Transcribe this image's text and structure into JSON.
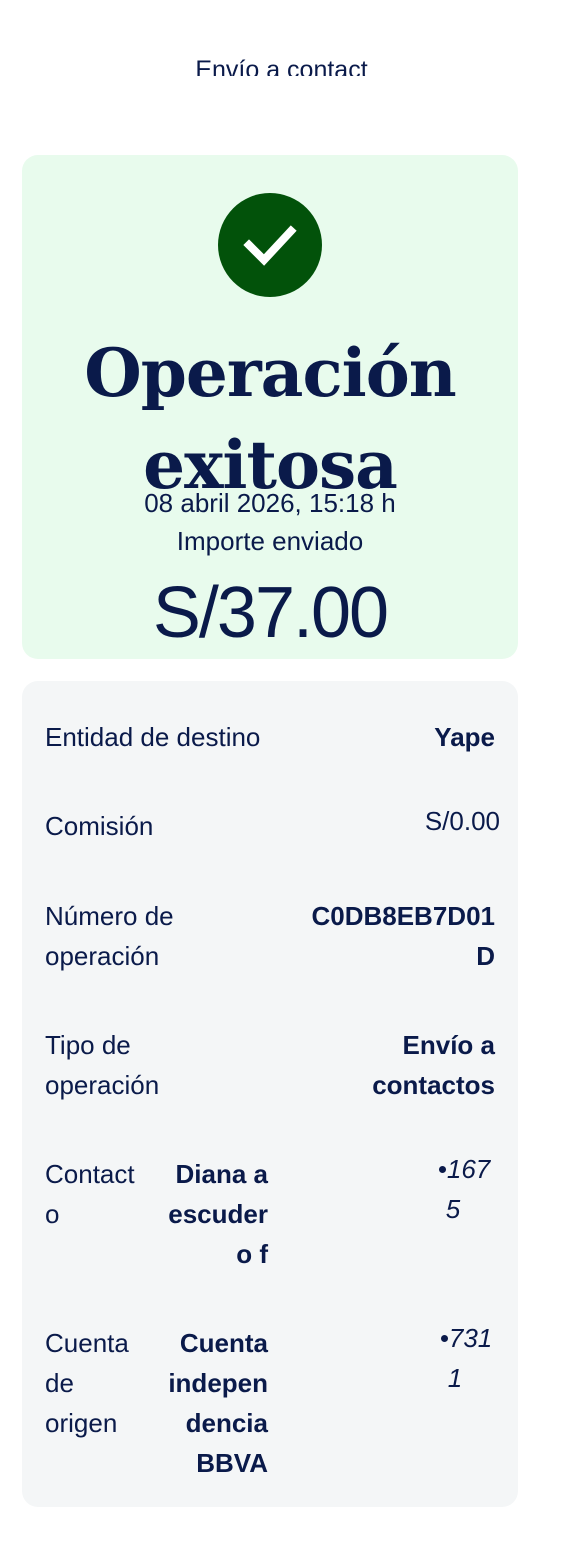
{
  "header": {
    "title": "Envío a contact"
  },
  "success": {
    "title_line1": "Operación",
    "title_line2": "exitosa",
    "datetime": "08 abril 2026, 15:18 h",
    "amount_label": "Importe enviado",
    "amount": "S/37.00",
    "accent_color": "#02520a",
    "background_color": "#e8fbed"
  },
  "details": {
    "destination": {
      "label": "Entidad de destino",
      "value": "Yape"
    },
    "commission": {
      "label": "Comisión",
      "value": "S/0.00"
    },
    "operation_number": {
      "label_line1": "Número de",
      "label_line2": "operación",
      "value_line1": "C0DB8EB7D01",
      "value_line2": "D"
    },
    "operation_type": {
      "label_line1": "Tipo de",
      "label_line2": "operación",
      "value_line1": "Envío a",
      "value_line2": "contactos"
    },
    "contact": {
      "label_line1": "Contact",
      "label_line2": "o",
      "name_line1": "Diana a",
      "name_line2": "escuder",
      "name_line3": "o f",
      "suffix_line1": "•167",
      "suffix_line2": "5"
    },
    "origin_account": {
      "label_line1": "Cuenta",
      "label_line2": "de",
      "label_line3": "origen",
      "name_line1": "Cuenta",
      "name_line2": "indepen",
      "name_line3": "dencia",
      "name_line4": "BBVA",
      "suffix_line1": "•731",
      "suffix_line2": "1"
    }
  }
}
